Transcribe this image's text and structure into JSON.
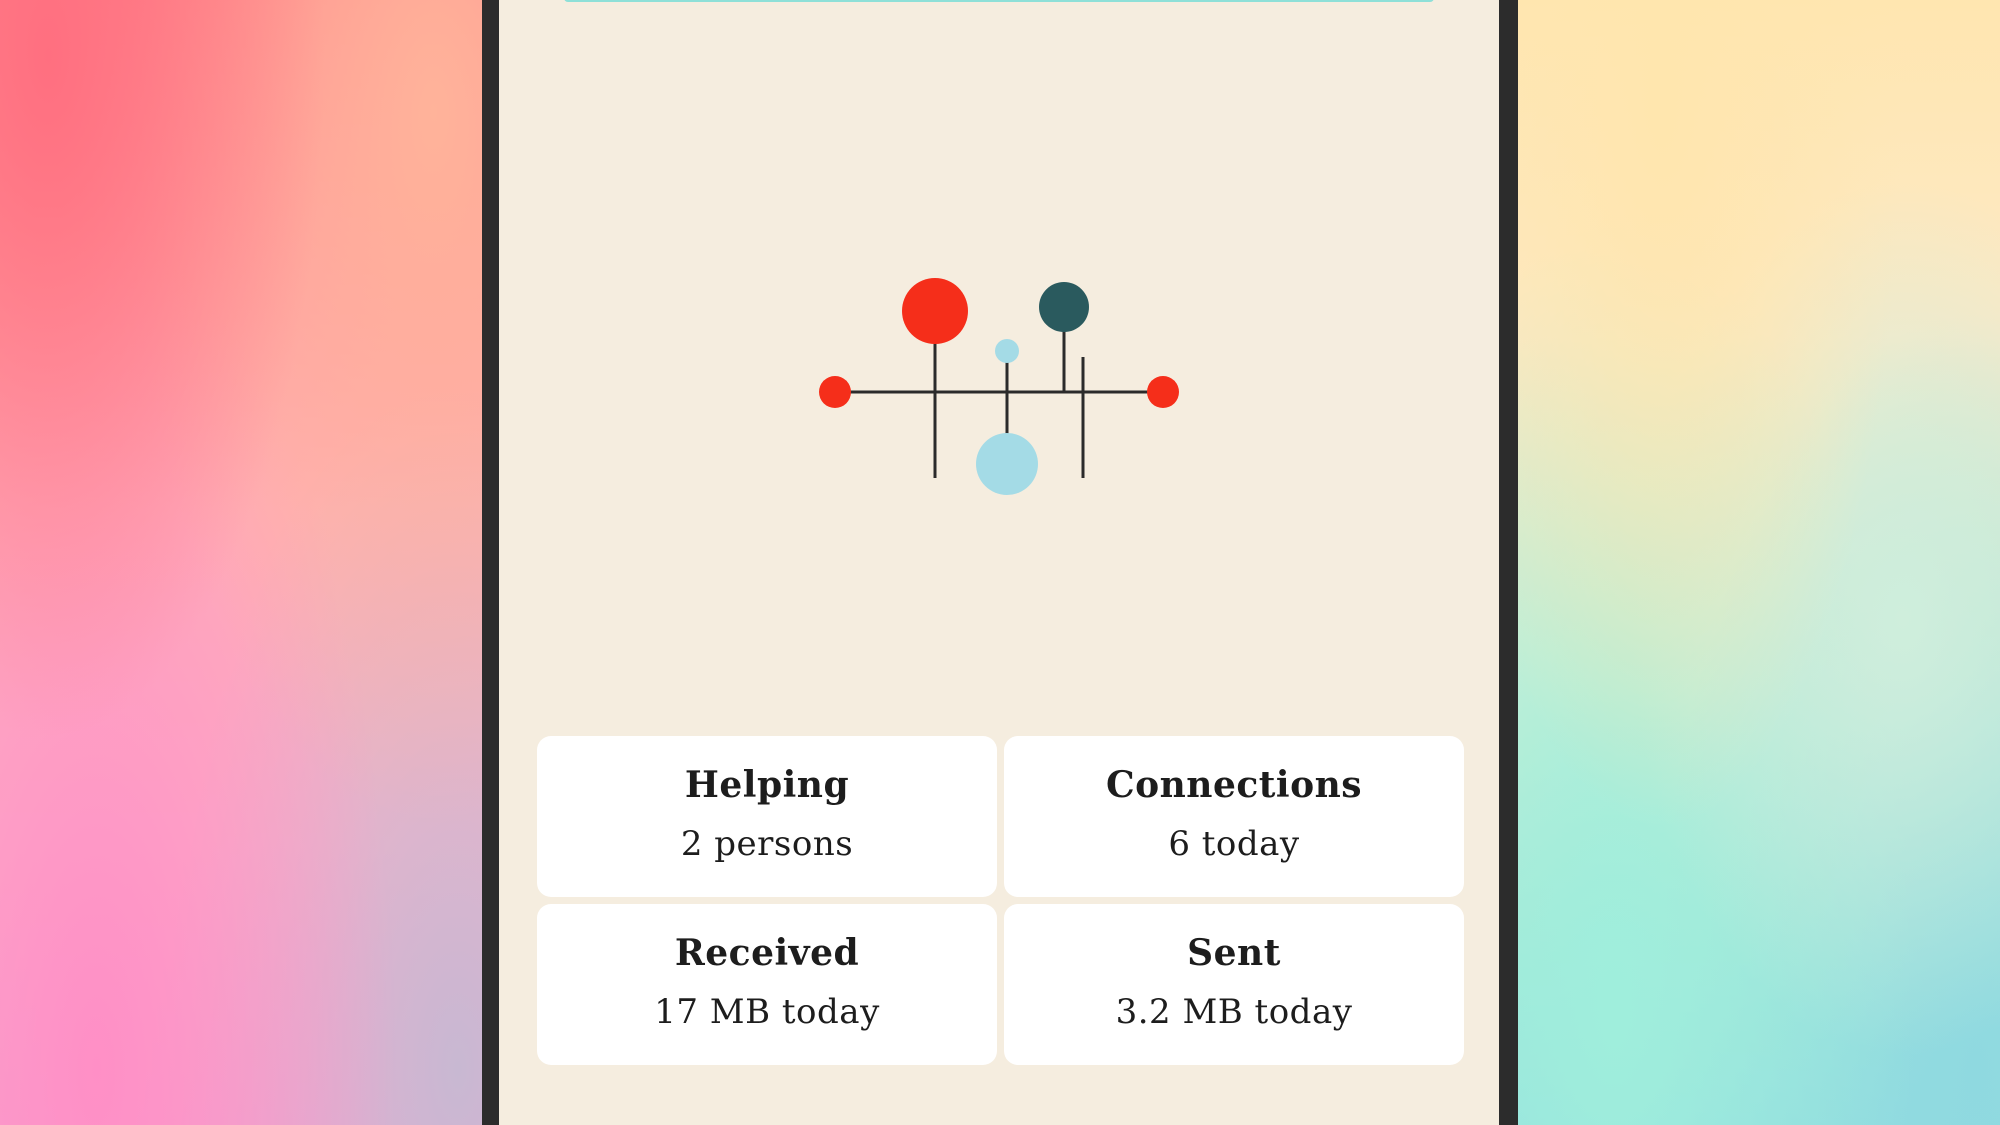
{
  "colors": {
    "screen_background": "#f5eddf",
    "accent_red": "#f52e1a",
    "accent_dark_teal": "#2a5a5e",
    "accent_light_blue": "#a4dbe6",
    "card_background": "#ffffff",
    "progress_bar": "#8ee0d8"
  },
  "stats": [
    {
      "label": "Helping",
      "value": "2 persons"
    },
    {
      "label": "Connections",
      "value": "6 today"
    },
    {
      "label": "Received",
      "value": "17 MB today"
    },
    {
      "label": "Sent",
      "value": "3.2 MB today"
    }
  ]
}
